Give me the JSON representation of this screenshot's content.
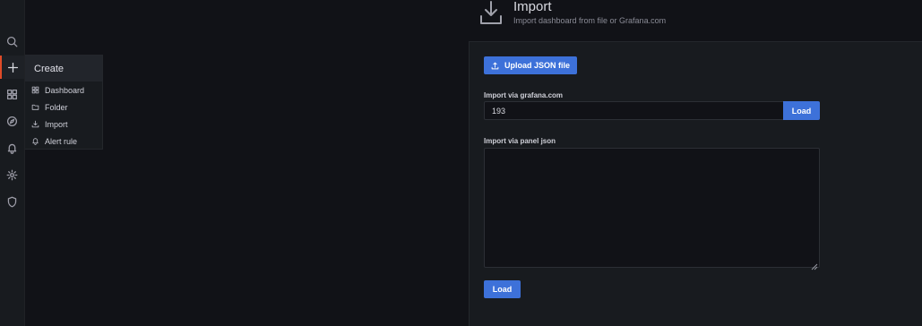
{
  "sidemenu": {
    "icons": [
      "search-icon",
      "plus-icon",
      "apps-icon",
      "compass-icon",
      "bell-icon",
      "cog-icon",
      "shield-icon"
    ]
  },
  "create_menu": {
    "header": "Create",
    "items": [
      {
        "label": "Dashboard",
        "icon": "apps-icon"
      },
      {
        "label": "Folder",
        "icon": "folder-icon"
      },
      {
        "label": "Import",
        "icon": "import-icon"
      },
      {
        "label": "Alert rule",
        "icon": "bell-icon"
      }
    ]
  },
  "header": {
    "title": "Import",
    "subtitle": "Import dashboard from file or Grafana.com"
  },
  "import": {
    "upload_label": "Upload JSON file",
    "grafana_label": "Import via grafana.com",
    "grafana_value": "193",
    "grafana_load_label": "Load",
    "panel_json_label": "Import via panel json",
    "panel_json_value": "",
    "load_label": "Load"
  },
  "colors": {
    "accent": "#e04b28",
    "primary_button": "#3d71d9",
    "background": "#111217",
    "panel": "#181b1f"
  }
}
